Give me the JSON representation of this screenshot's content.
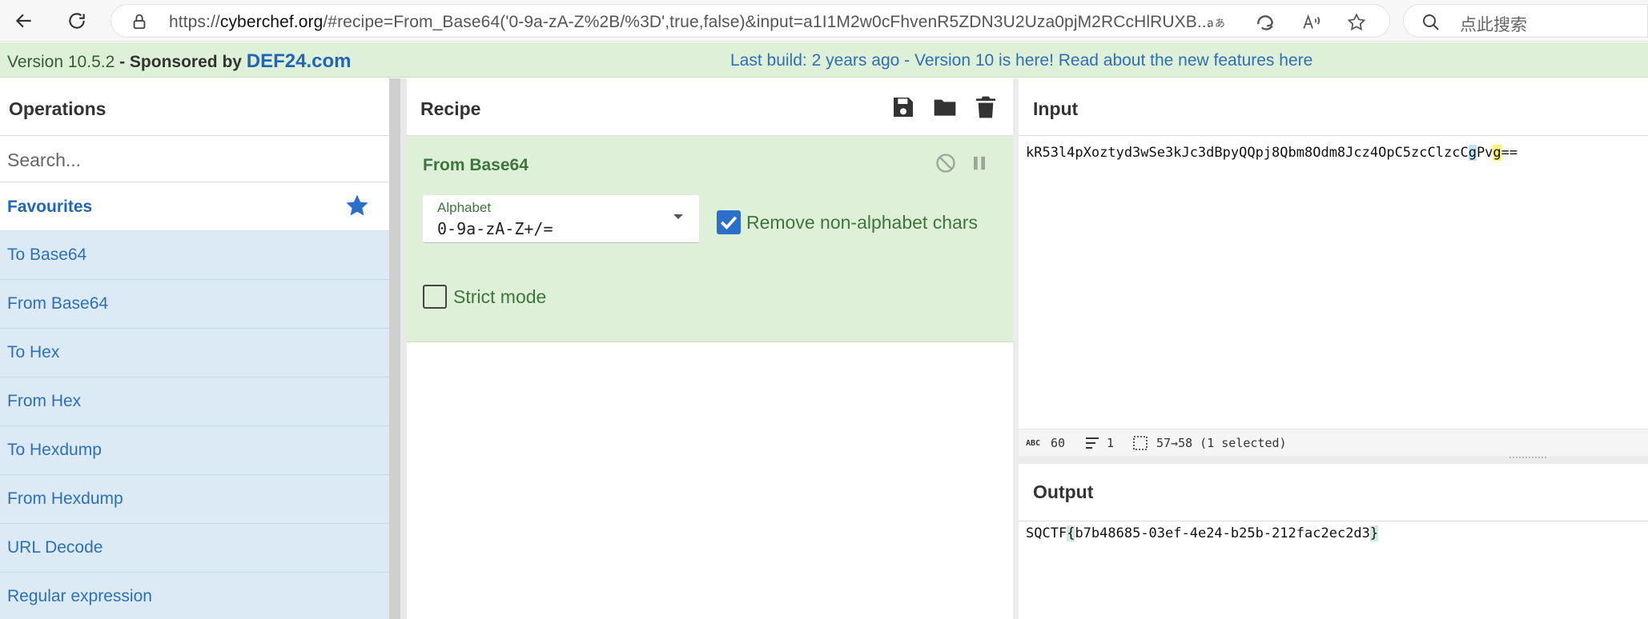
{
  "browser": {
    "url_prefix": "https://",
    "url_host": "cyberchef.org",
    "url_rest": "/#recipe=From_Base64('0-9a-zA-Z%2B/%3D',true,false)&input=a1I1M2w0cFhvenR5ZDN3U2Uza0pjM2RCcHlRUXB...",
    "search_placeholder": "点此搜索"
  },
  "banner": {
    "version_label": "Version 10.5.2",
    "sponsor_prefix": " - Sponsored by ",
    "sponsor_name": "DEF24.com",
    "build_notice": "Last build: 2 years ago - Version 10 is here! Read about the new features here"
  },
  "operations": {
    "title": "Operations",
    "search_placeholder": "Search...",
    "favourites_label": "Favourites",
    "items": [
      "To Base64",
      "From Base64",
      "To Hex",
      "From Hex",
      "To Hexdump",
      "From Hexdump",
      "URL Decode",
      "Regular expression"
    ]
  },
  "recipe": {
    "title": "Recipe",
    "operation": {
      "name": "From Base64",
      "alphabet_label": "Alphabet",
      "alphabet_value": "0-9a-zA-Z+/=",
      "remove_non_alphabet_label": "Remove non-alphabet chars",
      "remove_non_alphabet_checked": true,
      "strict_mode_label": "Strict mode",
      "strict_mode_checked": false
    }
  },
  "input": {
    "title": "Input",
    "text_before": "kR53l4pXoztyd3wSe3kJc3dBpyQQpj8Qbm8Odm8Jcz4OpC5zcClzcC",
    "text_hl_blue": "g",
    "text_mid": "Pv",
    "text_hl_yellow": "g",
    "text_after": "==",
    "status": {
      "abc_icon": "ABC",
      "char_count": "60",
      "line_count": "1",
      "selection": "57→58 (1 selected)"
    }
  },
  "output": {
    "title": "Output",
    "text_before": "SQCTF",
    "text_open_brace": "{",
    "text_mid": "b7b48685-03ef-4e24-b25b-212fac2ec2d3",
    "text_close_brace": "}"
  },
  "colors": {
    "banner_bg": "#dff0d8",
    "recipe_op_bg": "#dff0d8",
    "op_item_bg": "#dbeaf5",
    "link_blue": "#2e6fb6",
    "op_green": "#3c763d"
  }
}
